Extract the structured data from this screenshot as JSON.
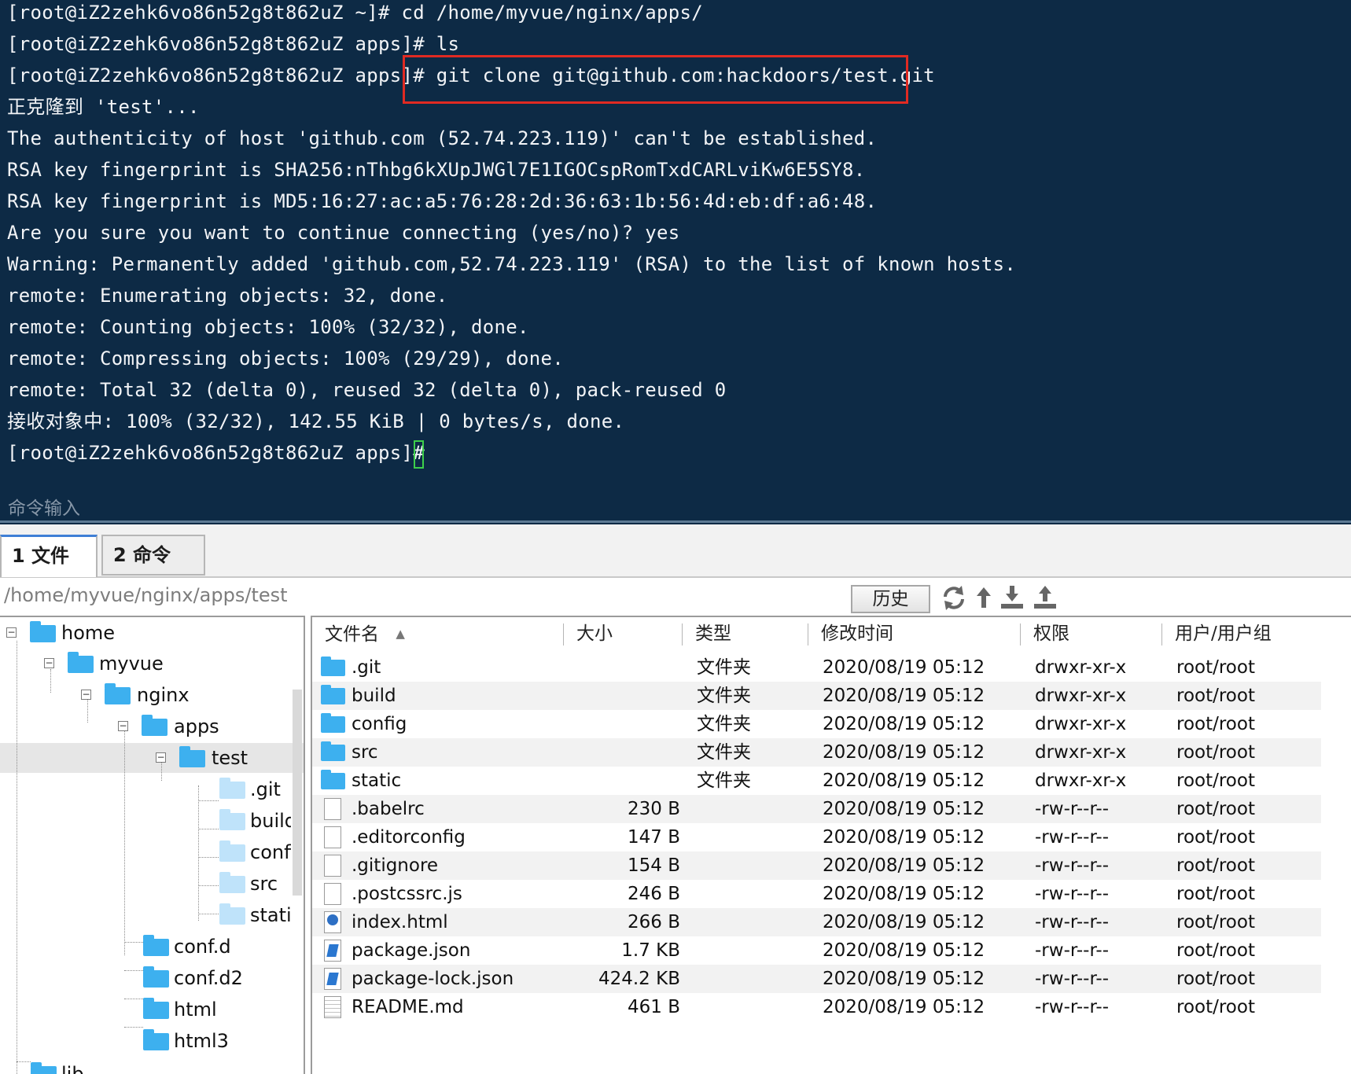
{
  "terminal": {
    "lines": [
      "[root@iZ2zehk6vo86n52g8t862uZ ~]# cd /home/myvue/nginx/apps/",
      "[root@iZ2zehk6vo86n52g8t862uZ apps]# ls",
      "[root@iZ2zehk6vo86n52g8t862uZ apps]# git clone git@github.com:hackdoors/test.git",
      "正克隆到 'test'...",
      "The authenticity of host 'github.com (52.74.223.119)' can't be established.",
      "RSA key fingerprint is SHA256:nThbg6kXUpJWGl7E1IGOCspRomTxdCARLviKw6E5SY8.",
      "RSA key fingerprint is MD5:16:27:ac:a5:76:28:2d:36:63:1b:56:4d:eb:df:a6:48.",
      "Are you sure you want to continue connecting (yes/no)? yes",
      "Warning: Permanently added 'github.com,52.74.223.119' (RSA) to the list of known hosts.",
      "remote: Enumerating objects: 32, done.",
      "remote: Counting objects: 100% (32/32), done.",
      "remote: Compressing objects: 100% (29/29), done.",
      "remote: Total 32 (delta 0), reused 32 (delta 0), pack-reused 0",
      "接收对象中: 100% (32/32), 142.55 KiB | 0 bytes/s, done.",
      "[root@iZ2zehk6vo86n52g8t862uZ apps]# "
    ],
    "command_input_placeholder": "命令输入",
    "highlight_color": "#e02a22",
    "background_color": "#0d2a45"
  },
  "tabs": [
    {
      "label": "1 文件",
      "active": true
    },
    {
      "label": "2 命令",
      "active": false
    }
  ],
  "pathbar": {
    "path": "/home/myvue/nginx/apps/test",
    "history_label": "历史",
    "icons": [
      "refresh-icon",
      "up-dir-icon",
      "download-icon",
      "upload-icon"
    ]
  },
  "tree": {
    "nodes": [
      {
        "label": "home"
      },
      {
        "label": "myvue"
      },
      {
        "label": "nginx"
      },
      {
        "label": "apps"
      },
      {
        "label": "test",
        "selected": true
      },
      {
        "label": ".git"
      },
      {
        "label": "build"
      },
      {
        "label": "config"
      },
      {
        "label": "src"
      },
      {
        "label": "static"
      },
      {
        "label": "conf.d"
      },
      {
        "label": "conf.d2"
      },
      {
        "label": "html"
      },
      {
        "label": "html3"
      },
      {
        "label": "lib"
      }
    ]
  },
  "filelist": {
    "columns": [
      "文件名",
      "大小",
      "类型",
      "修改时间",
      "权限",
      "用户/用户组"
    ],
    "sort_indicator": "▲",
    "rows": [
      {
        "name": ".git",
        "size": "",
        "type": "文件夹",
        "mtime": "2020/08/19 05:12",
        "perm": "drwxr-xr-x",
        "owner": "root/root",
        "icon": "folder"
      },
      {
        "name": "build",
        "size": "",
        "type": "文件夹",
        "mtime": "2020/08/19 05:12",
        "perm": "drwxr-xr-x",
        "owner": "root/root",
        "icon": "folder"
      },
      {
        "name": "config",
        "size": "",
        "type": "文件夹",
        "mtime": "2020/08/19 05:12",
        "perm": "drwxr-xr-x",
        "owner": "root/root",
        "icon": "folder"
      },
      {
        "name": "src",
        "size": "",
        "type": "文件夹",
        "mtime": "2020/08/19 05:12",
        "perm": "drwxr-xr-x",
        "owner": "root/root",
        "icon": "folder"
      },
      {
        "name": "static",
        "size": "",
        "type": "文件夹",
        "mtime": "2020/08/19 05:12",
        "perm": "drwxr-xr-x",
        "owner": "root/root",
        "icon": "folder"
      },
      {
        "name": ".babelrc",
        "size": "230 B",
        "type": "",
        "mtime": "2020/08/19 05:12",
        "perm": "-rw-r--r--",
        "owner": "root/root",
        "icon": "file"
      },
      {
        "name": ".editorconfig",
        "size": "147 B",
        "type": "",
        "mtime": "2020/08/19 05:12",
        "perm": "-rw-r--r--",
        "owner": "root/root",
        "icon": "file"
      },
      {
        "name": ".gitignore",
        "size": "154 B",
        "type": "",
        "mtime": "2020/08/19 05:12",
        "perm": "-rw-r--r--",
        "owner": "root/root",
        "icon": "file"
      },
      {
        "name": ".postcssrc.js",
        "size": "246 B",
        "type": "",
        "mtime": "2020/08/19 05:12",
        "perm": "-rw-r--r--",
        "owner": "root/root",
        "icon": "file"
      },
      {
        "name": "index.html",
        "size": "266 B",
        "type": "",
        "mtime": "2020/08/19 05:12",
        "perm": "-rw-r--r--",
        "owner": "root/root",
        "icon": "html"
      },
      {
        "name": "package.json",
        "size": "1.7 KB",
        "type": "",
        "mtime": "2020/08/19 05:12",
        "perm": "-rw-r--r--",
        "owner": "root/root",
        "icon": "json"
      },
      {
        "name": "package-lock.json",
        "size": "424.2 KB",
        "type": "",
        "mtime": "2020/08/19 05:12",
        "perm": "-rw-r--r--",
        "owner": "root/root",
        "icon": "json"
      },
      {
        "name": "README.md",
        "size": "461 B",
        "type": "",
        "mtime": "2020/08/19 05:12",
        "perm": "-rw-r--r--",
        "owner": "root/root",
        "icon": "md"
      }
    ]
  }
}
